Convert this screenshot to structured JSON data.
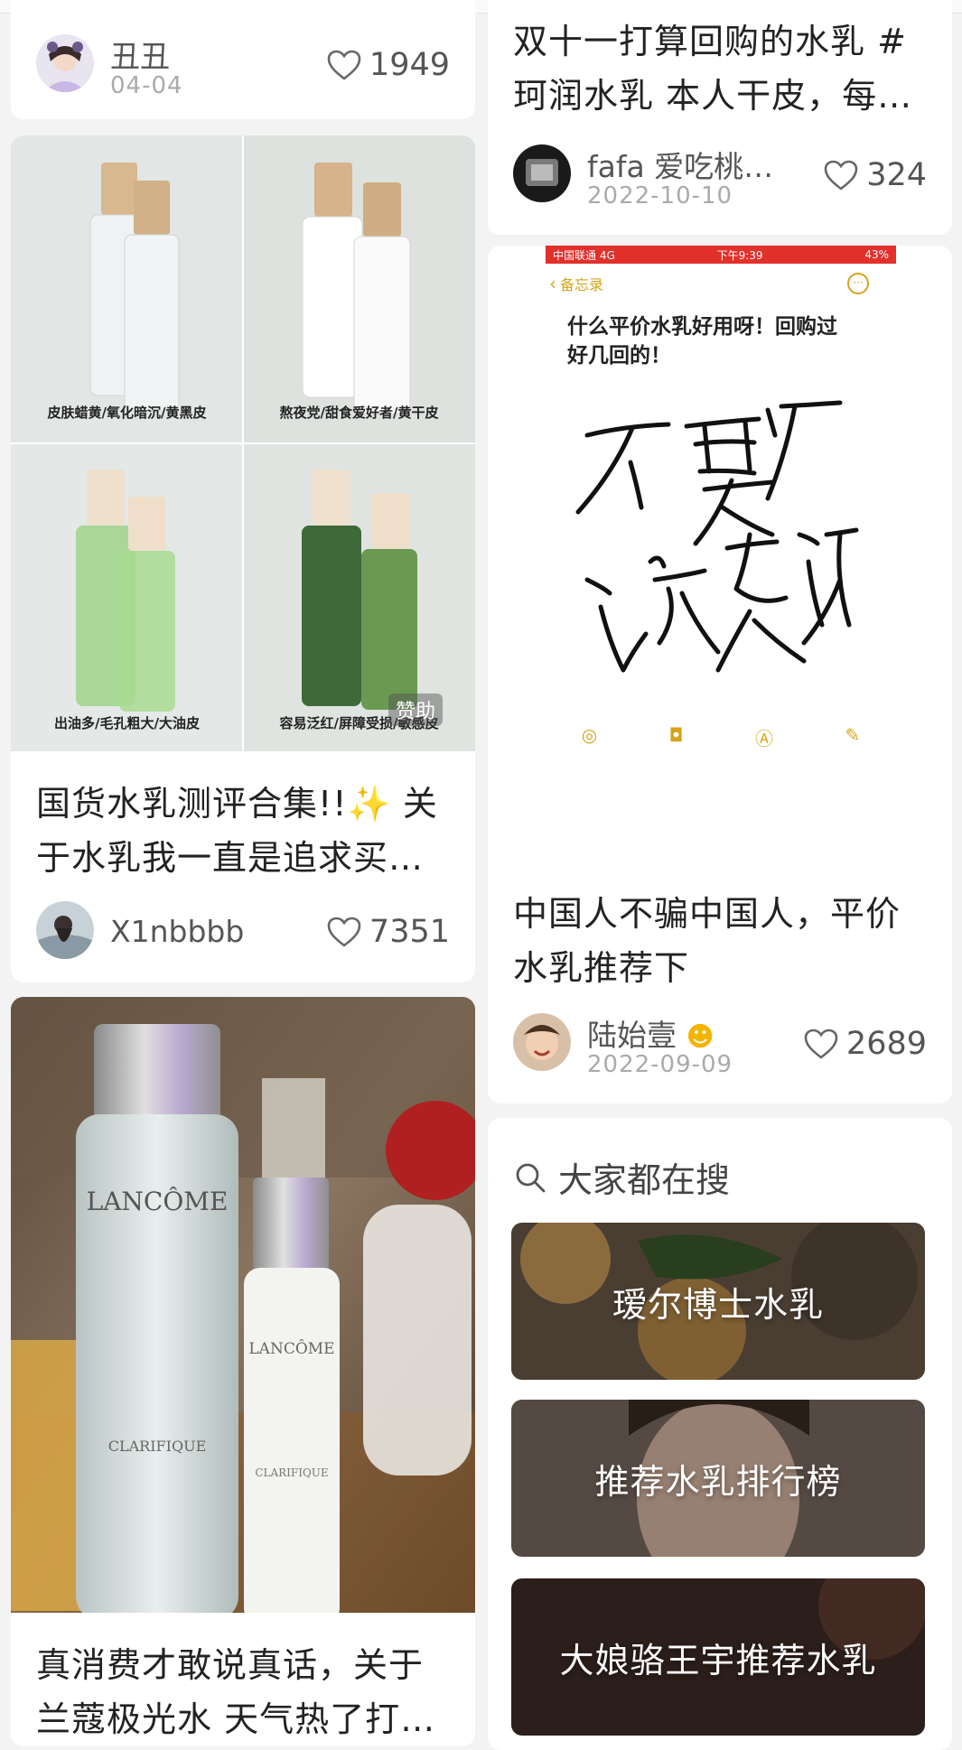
{
  "colors": {
    "background": "#f3f3f3",
    "card": "#ffffff",
    "text": "#222222",
    "muted": "#aaaaaa"
  },
  "left": {
    "post1": {
      "author": "丑丑",
      "date": "04-04",
      "likes": "1949"
    },
    "post2": {
      "image_captions": [
        "皮肤蜡黄/氧化暗沉/黄黑皮",
        "熬夜党/甜食爱好者/黄干皮",
        "出油多/毛孔粗大/大油皮",
        "容易泛红/屏障受损/敏感皮"
      ],
      "image_badge": "赞助",
      "title": "国货水乳测评合集!!✨ 关于水乳我一直是追求买…",
      "author": "X1nbbbb",
      "likes": "7351"
    },
    "post3": {
      "image_texts": {
        "brand": "LANCÔME",
        "product": "CLARIFIQUE"
      },
      "title": "真消费才敢说真话，关于兰蔻极光水 天气热了打…"
    }
  },
  "right": {
    "post1": {
      "title": "双十一打算回购的水乳 #珂润水乳  本人干皮，每…",
      "author": "fafa 爱吃桃子…",
      "date": "2022-10-10",
      "likes": "324"
    },
    "post2": {
      "phone_status": {
        "carrier": "中国联通  4G",
        "time": "下午9:39",
        "battery": "43%"
      },
      "note_back": "备忘录",
      "note_heading": "什么平价水乳好用呀！回购过好几回的！",
      "handwriting": "不要广 说真话",
      "title": "中国人不骗中国人，平价水乳推荐下",
      "author": "陆始壹",
      "date": "2022-09-09",
      "likes": "2689"
    },
    "search": {
      "label": "大家都在搜",
      "items": [
        "瑷尔博士水乳",
        "推荐水乳排行榜",
        "大娘骆王宇推荐水乳"
      ]
    }
  }
}
